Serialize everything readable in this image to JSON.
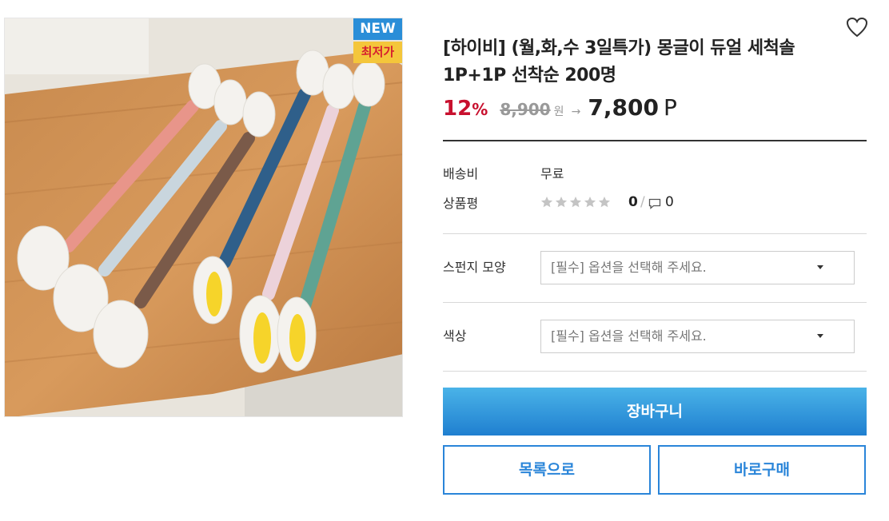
{
  "badges": {
    "new": "NEW",
    "lowest": "최저가"
  },
  "product": {
    "title_line1": "[하이비] (월,화,수 3일특가) 몽글이 듀얼 세척솔",
    "title_line2": "1P+1P 선착순 200명"
  },
  "price": {
    "discount_number": "12",
    "discount_symbol": "%",
    "original": "8,900",
    "original_unit": "원",
    "arrow": "→",
    "sale": "7,800",
    "sale_unit": "P"
  },
  "info": {
    "shipping_label": "배송비",
    "shipping_value": "무료",
    "review_label": "상품평",
    "rating_stars": 0,
    "rating_max": 5,
    "review_count": "0",
    "separator": "/",
    "comment_count": "0"
  },
  "options": [
    {
      "label": "스펀지 모양",
      "placeholder": "[필수] 옵션을 선택해 주세요."
    },
    {
      "label": "색상",
      "placeholder": "[필수] 옵션을 선택해 주세요."
    }
  ],
  "buttons": {
    "cart": "장바구니",
    "list": "목록으로",
    "buy_now": "바로구매"
  },
  "colors": {
    "discount": "#c8102e",
    "primary_blue": "#2a85d9",
    "new_badge": "#2a8ed8",
    "lowest_badge": "#f4c63b"
  }
}
